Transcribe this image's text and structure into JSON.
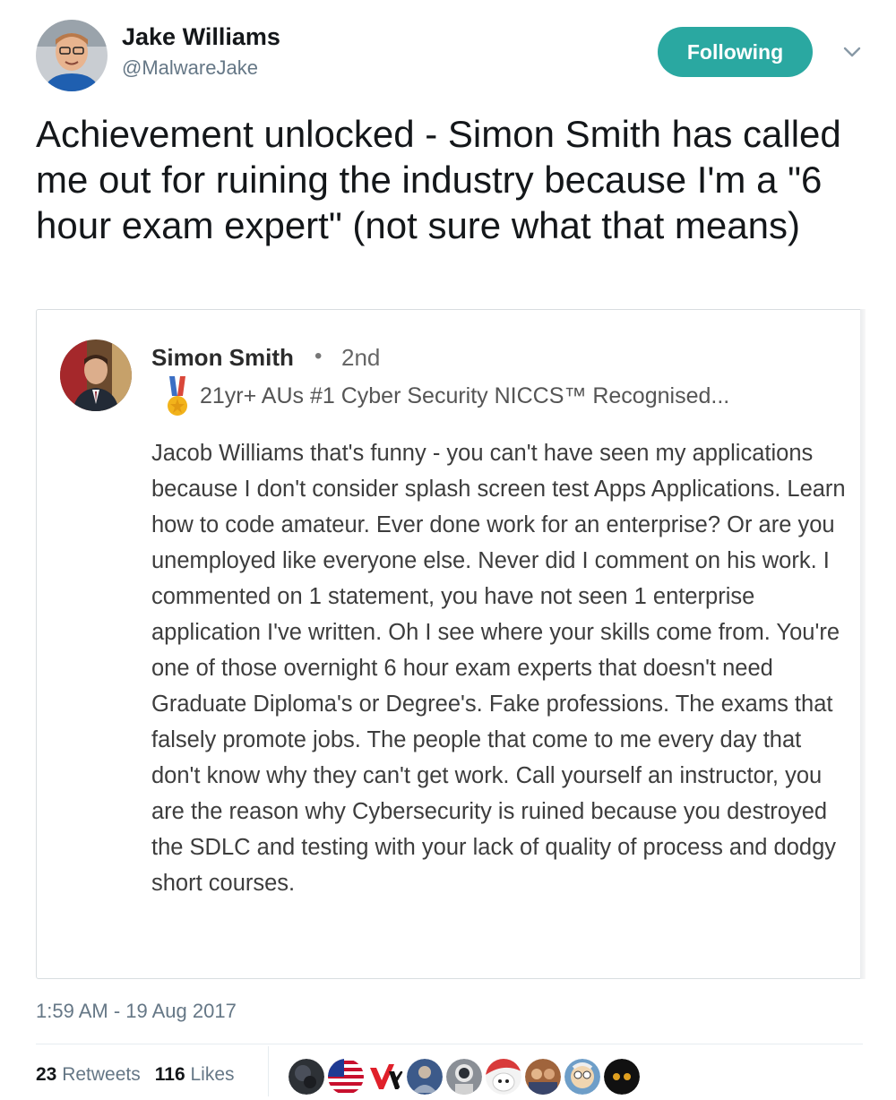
{
  "author": {
    "name": "Jake Williams",
    "handle": "@MalwareJake"
  },
  "follow_button": {
    "label": "Following",
    "color": "#2aa8a1"
  },
  "tweet": {
    "text": "Achievement unlocked - Simon Smith has called me out for ruining the industry because I'm a \"6 hour exam expert\" (not sure what that means)",
    "timestamp": "1:59 AM - 19 Aug 2017"
  },
  "quoted_post": {
    "name": "Simon Smith",
    "separator": "•",
    "degree": "2nd",
    "headline": "21yr+ AUs #1 Cyber Security NICCS™ Recognised...",
    "body": "Jacob Williams that's funny - you can't have seen my applications because I don't consider splash screen test Apps Applications. Learn how to code amateur. Ever done work for an enterprise? Or are you unemployed like everyone else. Never did I comment on his work. I commented on 1 statement, you have not seen 1 enterprise application I've written. Oh I see where your skills come from. You're one of those overnight 6 hour exam experts that doesn't need Graduate Diploma's or Degree's. Fake professions. The exams that falsely promote jobs. The people that come to me every day that don't know why they can't get work. Call yourself an instructor, you are the reason why Cybersecurity is ruined because you destroyed the SDLC and testing with your lack of quality of process and dodgy short courses."
  },
  "stats": {
    "retweets_count": "23",
    "retweets_label": "Retweets",
    "likes_count": "116",
    "likes_label": "Likes"
  },
  "likers": [
    {
      "icon": "dark-avatar-icon",
      "color": "#2d3136"
    },
    {
      "icon": "us-flag-icon",
      "color": "#c8102e"
    },
    {
      "icon": "vx-logo-icon",
      "color": "#e0202a"
    },
    {
      "icon": "person-avatar-icon",
      "color": "#3c5a8a"
    },
    {
      "icon": "astronaut-avatar-icon",
      "color": "#8a8f96"
    },
    {
      "icon": "robot-avatar-icon",
      "color": "#d83a3a"
    },
    {
      "icon": "group-avatar-icon",
      "color": "#a0643c"
    },
    {
      "icon": "cartoon-avatar-icon",
      "color": "#6e9ec8"
    },
    {
      "icon": "eyes-avatar-icon",
      "color": "#111111"
    }
  ]
}
